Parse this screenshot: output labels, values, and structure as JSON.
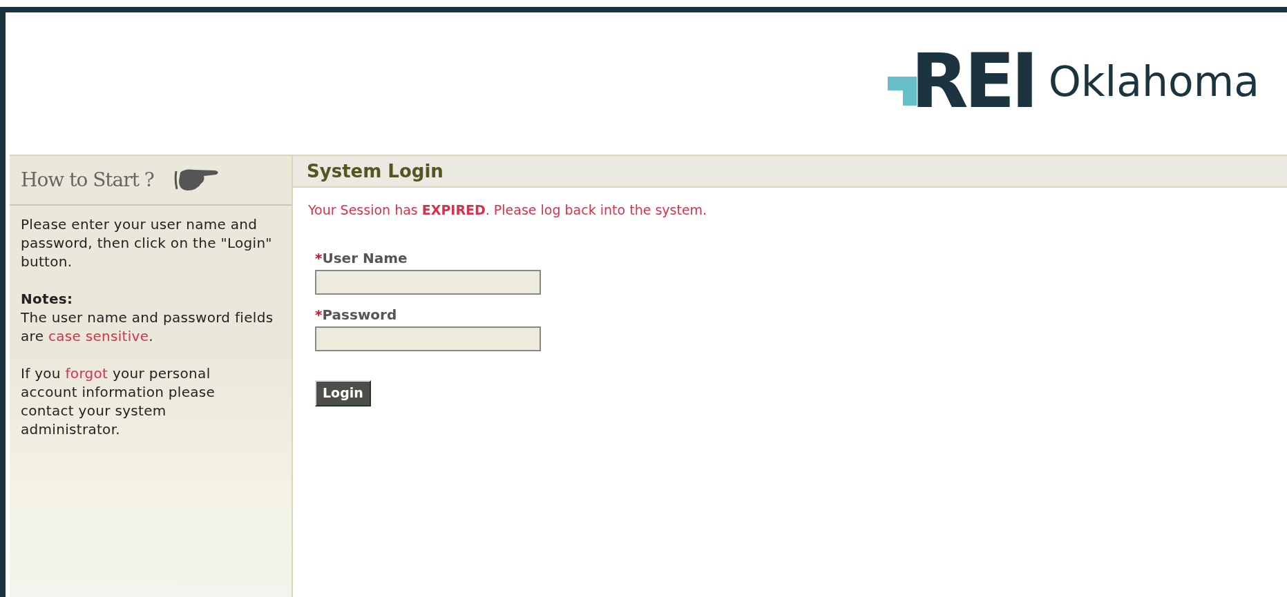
{
  "logo": {
    "mark": "REI",
    "text": "Oklahoma"
  },
  "sidebar": {
    "title": "How to Start ?",
    "paragraphs": [
      {
        "kind": "text",
        "text": "Please enter your user name and password, then click on the \"Login\" button."
      },
      {
        "kind": "notes",
        "heading": "Notes:",
        "before": "The user name and password fields are ",
        "link": "case sensitive",
        "after": "."
      },
      {
        "kind": "link",
        "before": "If you ",
        "link": "forgot",
        "after": " your personal account information please contact your system administrator."
      }
    ]
  },
  "main": {
    "title": "System Login",
    "message": "Your Session has **EXPIRED**. Please log back into the system.",
    "fields": [
      {
        "required_mark": "*",
        "label": "User Name"
      },
      {
        "required_mark": "*",
        "label": "Password"
      }
    ],
    "button": "Login"
  }
}
